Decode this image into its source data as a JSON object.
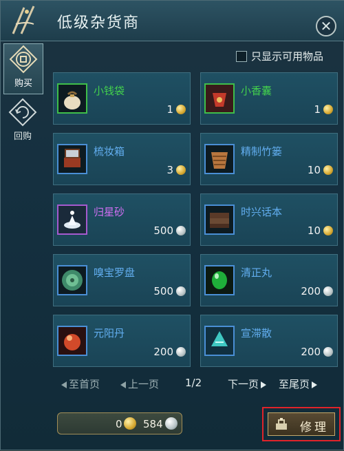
{
  "window": {
    "title": "低级杂货商",
    "close_icon": "close-icon"
  },
  "tabs": [
    {
      "label": "购买",
      "icon": "buy-icon",
      "active": true
    },
    {
      "label": "回购",
      "icon": "buyback-icon",
      "active": false
    }
  ],
  "filter": {
    "label": "只显示可用物品",
    "checked": false
  },
  "items": [
    {
      "name": "小钱袋",
      "price": "1",
      "currency": "gold",
      "rarity": "green",
      "icon": "money-pouch-icon"
    },
    {
      "name": "小香囊",
      "price": "1",
      "currency": "gold",
      "rarity": "green",
      "icon": "sachet-icon"
    },
    {
      "name": "梳妆箱",
      "price": "3",
      "currency": "gold",
      "rarity": "blue",
      "icon": "vanity-box-icon"
    },
    {
      "name": "精制竹篓",
      "price": "10",
      "currency": "gold",
      "rarity": "blue",
      "icon": "bamboo-basket-icon"
    },
    {
      "name": "归星砂",
      "price": "500",
      "currency": "silver",
      "rarity": "purple",
      "icon": "star-sand-icon"
    },
    {
      "name": "时兴话本",
      "price": "10",
      "currency": "gold",
      "rarity": "blue",
      "icon": "story-book-icon"
    },
    {
      "name": "嗅宝罗盘",
      "price": "500",
      "currency": "silver",
      "rarity": "blue",
      "icon": "treasure-compass-icon"
    },
    {
      "name": "清正丸",
      "price": "200",
      "currency": "silver",
      "rarity": "blue",
      "icon": "green-pill-icon"
    },
    {
      "name": "元阳丹",
      "price": "200",
      "currency": "silver",
      "rarity": "blue",
      "icon": "red-pill-icon"
    },
    {
      "name": "宣滞散",
      "price": "200",
      "currency": "silver",
      "rarity": "blue",
      "icon": "powder-packet-icon"
    }
  ],
  "pager": {
    "first": "至首页",
    "prev": "上一页",
    "page": "1/2",
    "next": "下一页",
    "last": "至尾页"
  },
  "wallet": {
    "gold": "0",
    "silver": "584"
  },
  "repair": {
    "label": "修理",
    "icon": "repair-icon"
  },
  "colors": {
    "green": "#43cf4d",
    "blue": "#62aef0",
    "purple": "#d06ff3",
    "highlight": "#e0232a"
  }
}
